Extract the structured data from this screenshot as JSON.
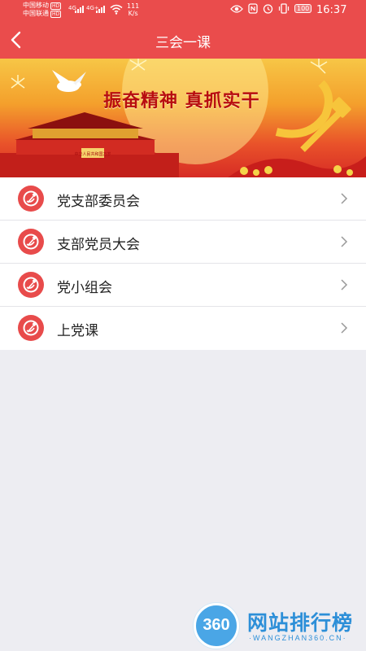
{
  "status_bar": {
    "carrier1": "中国移动",
    "carrier2": "中国联通",
    "hd_badge": "HD",
    "net_type1": "4G",
    "net_type2": "4G+",
    "speed_value": "111",
    "speed_unit": "K/s",
    "battery": "100",
    "time": "16:37"
  },
  "navbar": {
    "title": "三会一课",
    "back_icon": "chevron-left-icon"
  },
  "banner": {
    "slogan": "振奋精神  真抓实干",
    "gate_sign": "中华人民共和国万岁"
  },
  "menu": {
    "items": [
      {
        "label": "党支部委员会",
        "icon": "party-emblem-icon"
      },
      {
        "label": "支部党员大会",
        "icon": "party-emblem-icon"
      },
      {
        "label": "党小组会",
        "icon": "party-emblem-icon"
      },
      {
        "label": "上党课",
        "icon": "party-emblem-icon"
      }
    ]
  },
  "watermark": {
    "logo_text": "360",
    "title": "网站排行榜",
    "domain": "·WANGZHAN360.CN·"
  },
  "colors": {
    "primary": "#ea4c4c",
    "background": "#ededf2",
    "watermark_blue": "#2d8fd8"
  }
}
